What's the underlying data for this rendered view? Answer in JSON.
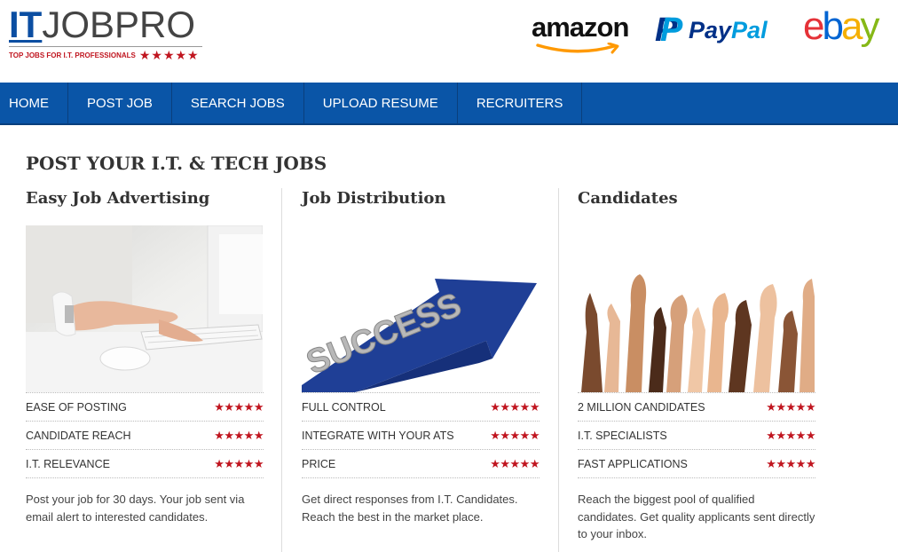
{
  "logo": {
    "it": "IT",
    "rest": "JOBPRO",
    "tagline": "TOP JOBS FOR I.T. PROFESSIONALS",
    "stars": "★★★★★"
  },
  "brands": {
    "amazon": "amazon",
    "paypal_pay": "Pay",
    "paypal_pal": "Pal",
    "paypal_mark": "P",
    "ebay": [
      "e",
      "b",
      "a",
      "y"
    ]
  },
  "nav": {
    "items": [
      "HOME",
      "POST JOB",
      "SEARCH JOBS",
      "UPLOAD RESUME",
      "RECRUITERS"
    ]
  },
  "page_title": "POST YOUR I.T. & TECH JOBS",
  "columns": [
    {
      "title": "Easy Job Advertising",
      "features": [
        "EASE OF POSTING",
        "CANDIDATE REACH",
        "I.T. RELEVANCE"
      ],
      "description": "Post your job for 30 days. Your job sent via email alert to interested candidates."
    },
    {
      "title": "Job Distribution",
      "image_text": "SUCCESS",
      "features": [
        "FULL CONTROL",
        "INTEGRATE WITH YOUR ATS",
        "PRICE"
      ],
      "description": "Get direct responses from I.T. Candidates. Reach the best in the market place."
    },
    {
      "title": "Candidates",
      "features": [
        "2 MILLION CANDIDATES",
        "I.T. SPECIALISTS",
        "FAST APPLICATIONS"
      ],
      "description": "Reach the biggest pool of qualified candidates. Get quality applicants sent directly to your inbox."
    }
  ],
  "rating_stars": "★★★★★",
  "colors": {
    "nav_bg": "#0a55a7",
    "star": "#c0151f",
    "logo_blue": "#0b4ea2"
  }
}
